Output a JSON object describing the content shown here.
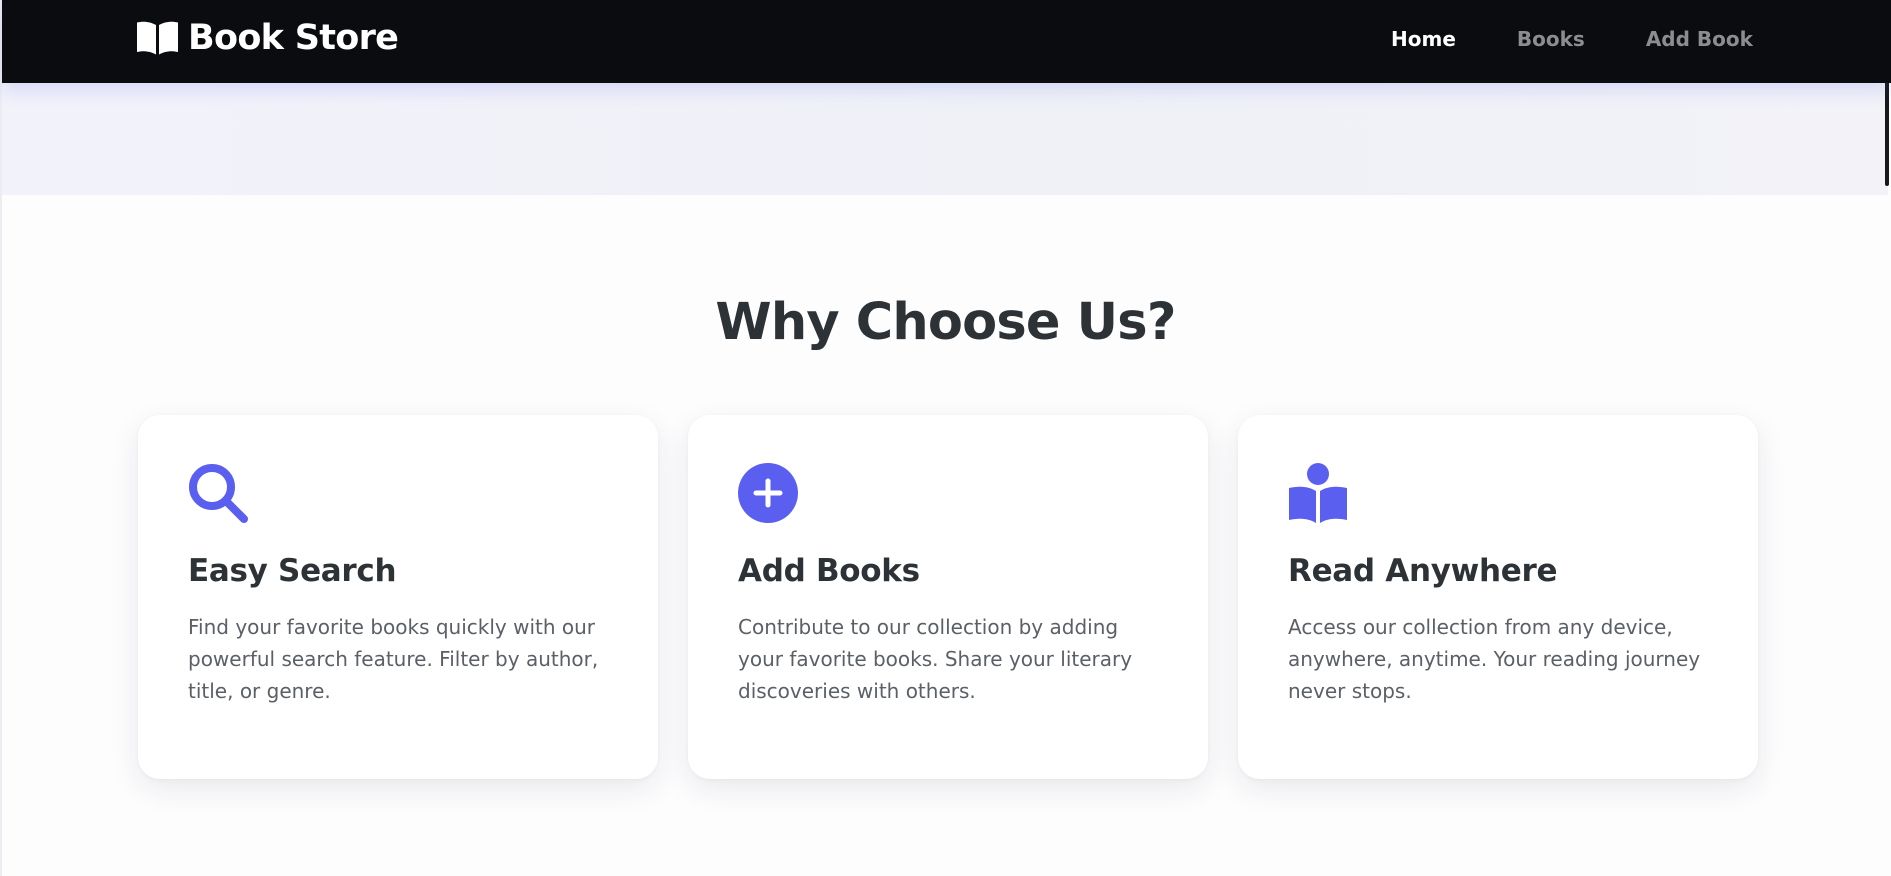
{
  "brand": {
    "name": "Book Store",
    "icon": "open-book-icon"
  },
  "nav": {
    "items": [
      {
        "label": "Home",
        "active": true
      },
      {
        "label": "Books",
        "active": false
      },
      {
        "label": "Add Book",
        "active": false
      }
    ]
  },
  "features": {
    "title": "Why Choose Us?",
    "cards": [
      {
        "icon": "search-icon",
        "title": "Easy Search",
        "text": "Find your favorite books quickly with our powerful search feature. Filter by author, title, or genre."
      },
      {
        "icon": "plus-circle-icon",
        "title": "Add Books",
        "text": "Contribute to our collection by adding your favorite books. Share your literary discoveries with others."
      },
      {
        "icon": "book-reader-icon",
        "title": "Read Anywhere",
        "text": "Access our collection from any device, anywhere, anytime. Your reading journey never stops."
      }
    ]
  },
  "colors": {
    "accent": "#5b5ff0",
    "navbar": "#0b0c0f",
    "heading": "#2d3236",
    "body_text": "#5b6067",
    "nav_inactive": "#8b8d91"
  }
}
